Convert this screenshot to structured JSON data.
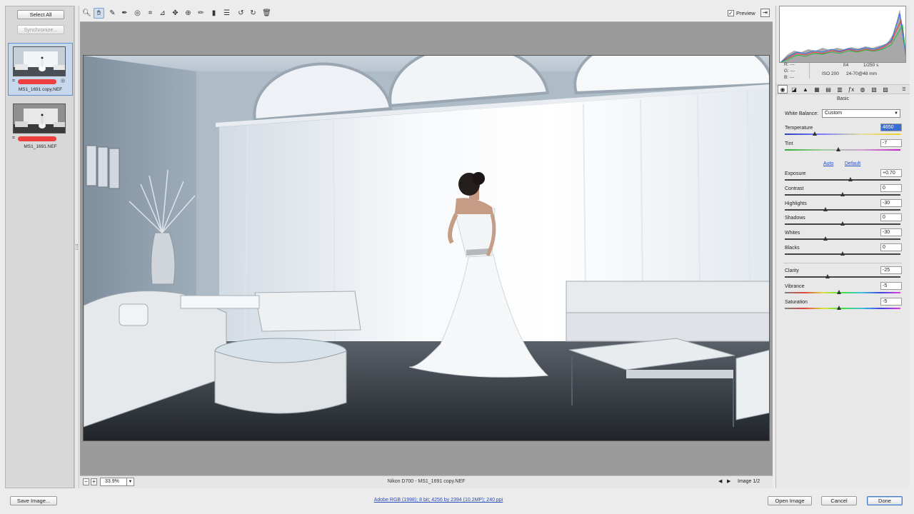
{
  "filmstrip": {
    "select_all_label": "Select All",
    "synchronize_label": "Synchronize...",
    "items": [
      {
        "name": "MS1_1691 copy.NEF",
        "selected": true
      },
      {
        "name": "MS1_1691.NEF",
        "selected": false
      }
    ]
  },
  "toolbar": {
    "tools": [
      "zoom-tool-icon",
      "hand-tool-icon",
      "white-balance-tool-icon",
      "color-sampler-tool-icon",
      "targeted-adjustment-tool-icon",
      "crop-tool-icon",
      "straighten-tool-icon",
      "spot-removal-tool-icon",
      "red-eye-tool-icon",
      "adjustment-brush-icon",
      "graduated-filter-icon",
      "radial-filter-icon",
      "preferences-icon",
      "rotate-left-icon",
      "rotate-right-icon",
      "trash-icon"
    ],
    "preview_label": "Preview",
    "preview_checked": true
  },
  "statusbar": {
    "zoom": "33.9%",
    "camera_file": "Nikon D700  -  MS1_1691 copy.NEF",
    "image_counter": "Image 1/2"
  },
  "info": {
    "r": "R:  ---",
    "g": "G:  ---",
    "b": "B:  ---",
    "aperture": "f/4",
    "shutter": "1/250 s",
    "iso": "ISO 200",
    "lens": "24-70@48 mm"
  },
  "panel": {
    "section_title": "Basic",
    "white_balance_label": "White Balance:",
    "white_balance_value": "Custom",
    "auto_label": "Auto",
    "default_label": "Default",
    "sliders": [
      {
        "label": "Temperature",
        "value": "4650",
        "pos": 0.26,
        "track": "temp"
      },
      {
        "label": "Tint",
        "value": "-7",
        "pos": 0.46,
        "track": "tint"
      },
      {
        "label": "Exposure",
        "value": "+0.70",
        "pos": 0.57,
        "track": "gray"
      },
      {
        "label": "Contrast",
        "value": "0",
        "pos": 0.5,
        "track": "gray"
      },
      {
        "label": "Highlights",
        "value": "-30",
        "pos": 0.35,
        "track": "gray"
      },
      {
        "label": "Shadows",
        "value": "0",
        "pos": 0.5,
        "track": "gray"
      },
      {
        "label": "Whites",
        "value": "-30",
        "pos": 0.35,
        "track": "gray"
      },
      {
        "label": "Blacks",
        "value": "0",
        "pos": 0.5,
        "track": "gray"
      },
      {
        "label": "Clarity",
        "value": "-25",
        "pos": 0.37,
        "track": "gray"
      },
      {
        "label": "Vibrance",
        "value": "-5",
        "pos": 0.47,
        "track": "vib"
      },
      {
        "label": "Saturation",
        "value": "-5",
        "pos": 0.47,
        "track": "sat"
      }
    ]
  },
  "bottom": {
    "save_label": "Save Image...",
    "workflow_link": "Adobe RGB (1998); 8 bit; 4256 by 2394 (10.2MP); 240 ppi",
    "open_label": "Open Image",
    "cancel_label": "Cancel",
    "done_label": "Done"
  }
}
